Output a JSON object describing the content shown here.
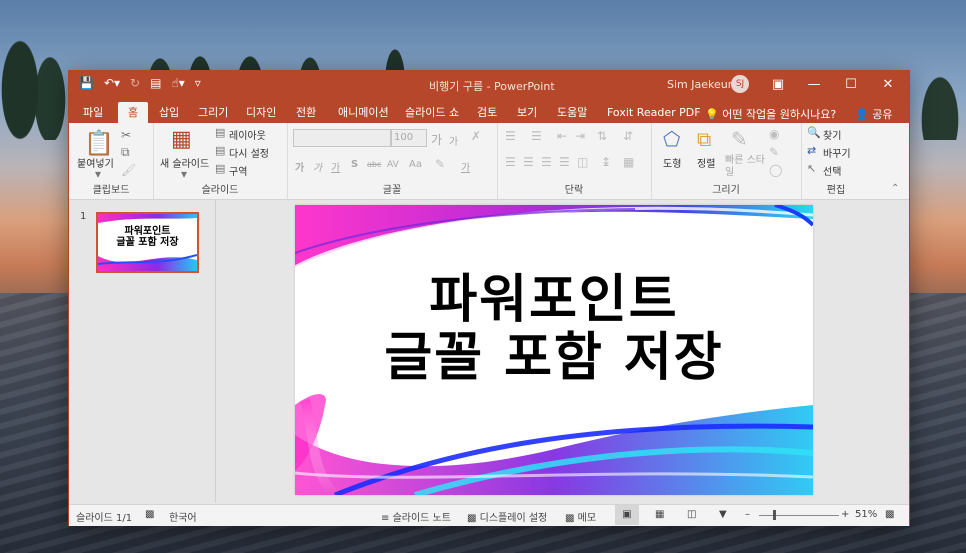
{
  "window": {
    "title": "비행기 구름  -  PowerPoint",
    "user_name": "Sim Jaekeun",
    "user_initials": "SJ",
    "accent_color": "#b7472a"
  },
  "tabs": [
    {
      "label": "파일"
    },
    {
      "label": "홈"
    },
    {
      "label": "삽입"
    },
    {
      "label": "그리기"
    },
    {
      "label": "디자인"
    },
    {
      "label": "전환"
    },
    {
      "label": "애니메이션"
    },
    {
      "label": "슬라이드 쇼"
    },
    {
      "label": "검토"
    },
    {
      "label": "보기"
    },
    {
      "label": "도움말"
    },
    {
      "label": "Foxit Reader PDF"
    }
  ],
  "tell_me": "어떤 작업을 원하시나요?",
  "share_label": "공유",
  "ribbon": {
    "clipboard": {
      "paste": "붙여넣기",
      "label": "클립보드"
    },
    "slides": {
      "new_slide": "새 슬라이드",
      "layout": "레이아웃",
      "reset": "다시 설정",
      "section": "구역",
      "label": "슬라이드"
    },
    "font": {
      "size": "100",
      "label": "글꼴",
      "bold": "가",
      "italic": "가",
      "underline": "가",
      "shadow": "S",
      "strike": "abc",
      "spacing": "AV",
      "case": "Aa",
      "grow": "가",
      "shrink": "가"
    },
    "paragraph": {
      "label": "단락"
    },
    "drawing": {
      "shapes": "도형",
      "arrange": "정렬",
      "quick_styles": "빠른 스타일",
      "label": "그리기"
    },
    "editing": {
      "find": "찾기",
      "replace": "바꾸기",
      "select": "선택",
      "label": "편집"
    }
  },
  "thumbnails": [
    {
      "number": "1",
      "line1": "파워포인트",
      "line2": "글꼴 포함 저장"
    }
  ],
  "slide": {
    "line1": "파워포인트",
    "line2": "글꼴 포함 저장"
  },
  "statusbar": {
    "slide_count": "슬라이드 1/1",
    "language": "한국어",
    "notes": "슬라이드 노트",
    "display": "디스플레이 설정",
    "comments": "메모",
    "zoom": "51%"
  }
}
